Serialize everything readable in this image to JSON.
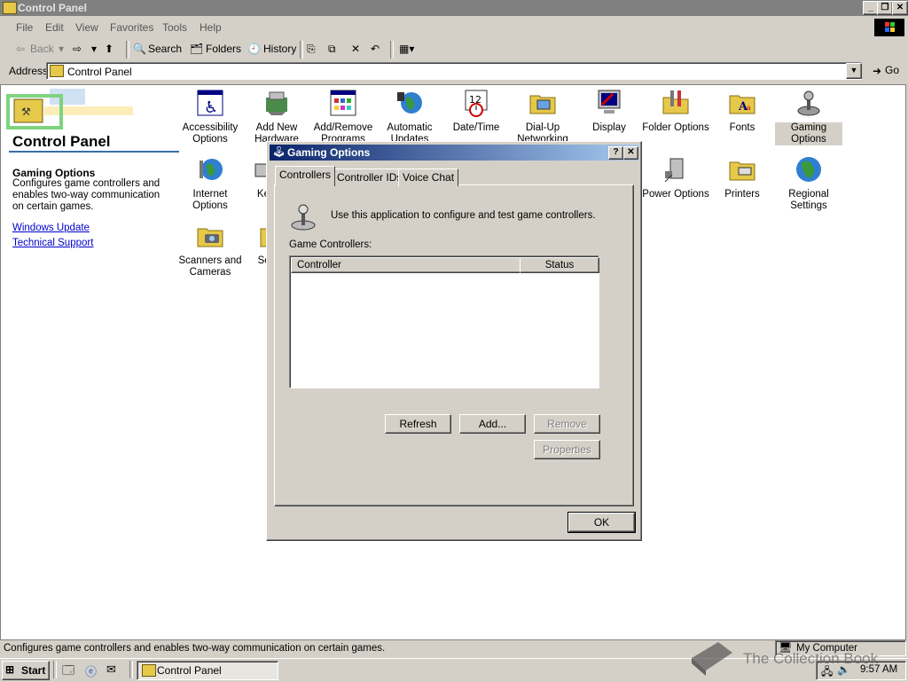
{
  "window": {
    "title": "Control Panel"
  },
  "menu": [
    "File",
    "Edit",
    "View",
    "Favorites",
    "Tools",
    "Help"
  ],
  "toolbar": {
    "back": "Back",
    "search": "Search",
    "folders": "Folders",
    "history": "History"
  },
  "address": {
    "label": "Address",
    "value": "Control Panel",
    "go": "Go"
  },
  "left": {
    "title": "Control Panel",
    "selected_name": "Gaming Options",
    "selected_desc": "Configures game controllers and enables two-way communication on certain games.",
    "links": [
      "Windows Update",
      "Technical Support"
    ]
  },
  "icons": {
    "row1": [
      "Accessibility Options",
      "Add New Hardware",
      "Add/Remove Programs",
      "Automatic Updates",
      "Date/Time",
      "Dial-Up Networking",
      "Display",
      "Folder Options",
      "Fonts",
      "Gaming Options"
    ],
    "row2": [
      "Internet Options",
      "Ke",
      "Power Options",
      "Printers",
      "Regional Settings"
    ],
    "row3": [
      "Scanners and Cameras",
      "Sc"
    ]
  },
  "dialog": {
    "title": "Gaming Options",
    "help": "?",
    "close": "✕",
    "tabs": [
      "Controllers",
      "Controller IDs",
      "Voice Chat"
    ],
    "description": "Use this application to configure and test game controllers.",
    "list_label": "Game Controllers:",
    "columns": [
      "Controller",
      "Status"
    ],
    "buttons": {
      "refresh": "Refresh",
      "add": "Add...",
      "remove": "Remove",
      "properties": "Properties",
      "ok": "OK"
    }
  },
  "status": {
    "text": "Configures game controllers and enables two-way communication on certain games.",
    "zone": "My Computer"
  },
  "taskbar": {
    "start": "Start",
    "task": "Control Panel",
    "clock": "9:57 AM"
  },
  "watermark": "The Collection Book"
}
